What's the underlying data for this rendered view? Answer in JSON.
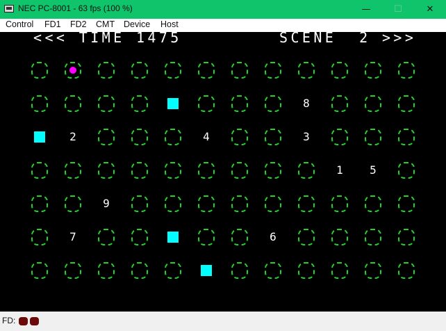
{
  "window": {
    "title": "NEC PC-8001 - 63 fps (100 %)",
    "minimize_glyph": "—",
    "maximize_glyph": "☐",
    "close_glyph": "✕"
  },
  "menu": [
    "Control",
    "FD1",
    "FD2",
    "CMT",
    "Device",
    "Host"
  ],
  "game": {
    "time_text": "<<< TIME 1475",
    "scene_text": "SCENE  2 >>>",
    "grid_rows": 7,
    "grid_cols": 12,
    "numbers": [
      {
        "label": "8",
        "row": 1,
        "col": 8
      },
      {
        "label": "2",
        "row": 2,
        "col": 1
      },
      {
        "label": "4",
        "row": 2,
        "col": 5
      },
      {
        "label": "3",
        "row": 2,
        "col": 8
      },
      {
        "label": "1",
        "row": 3,
        "col": 9
      },
      {
        "label": "5",
        "row": 3,
        "col": 10
      },
      {
        "label": "9",
        "row": 4,
        "col": 2
      },
      {
        "label": "7",
        "row": 5,
        "col": 1
      },
      {
        "label": "6",
        "row": 5,
        "col": 7
      }
    ],
    "tiles": [
      {
        "row": 1,
        "col": 4
      },
      {
        "row": 2,
        "col": 0
      },
      {
        "row": 5,
        "col": 4
      },
      {
        "row": 6,
        "col": 5
      }
    ],
    "player": {
      "row": 0,
      "col": 1
    },
    "colors": {
      "background": "#000000",
      "grid": "#22d22d",
      "tile": "#00ffff",
      "player": "#ff00ff",
      "text": "#ffffff"
    }
  },
  "status": {
    "fd_label": "FD:",
    "led_color": "#6b0a0a"
  }
}
